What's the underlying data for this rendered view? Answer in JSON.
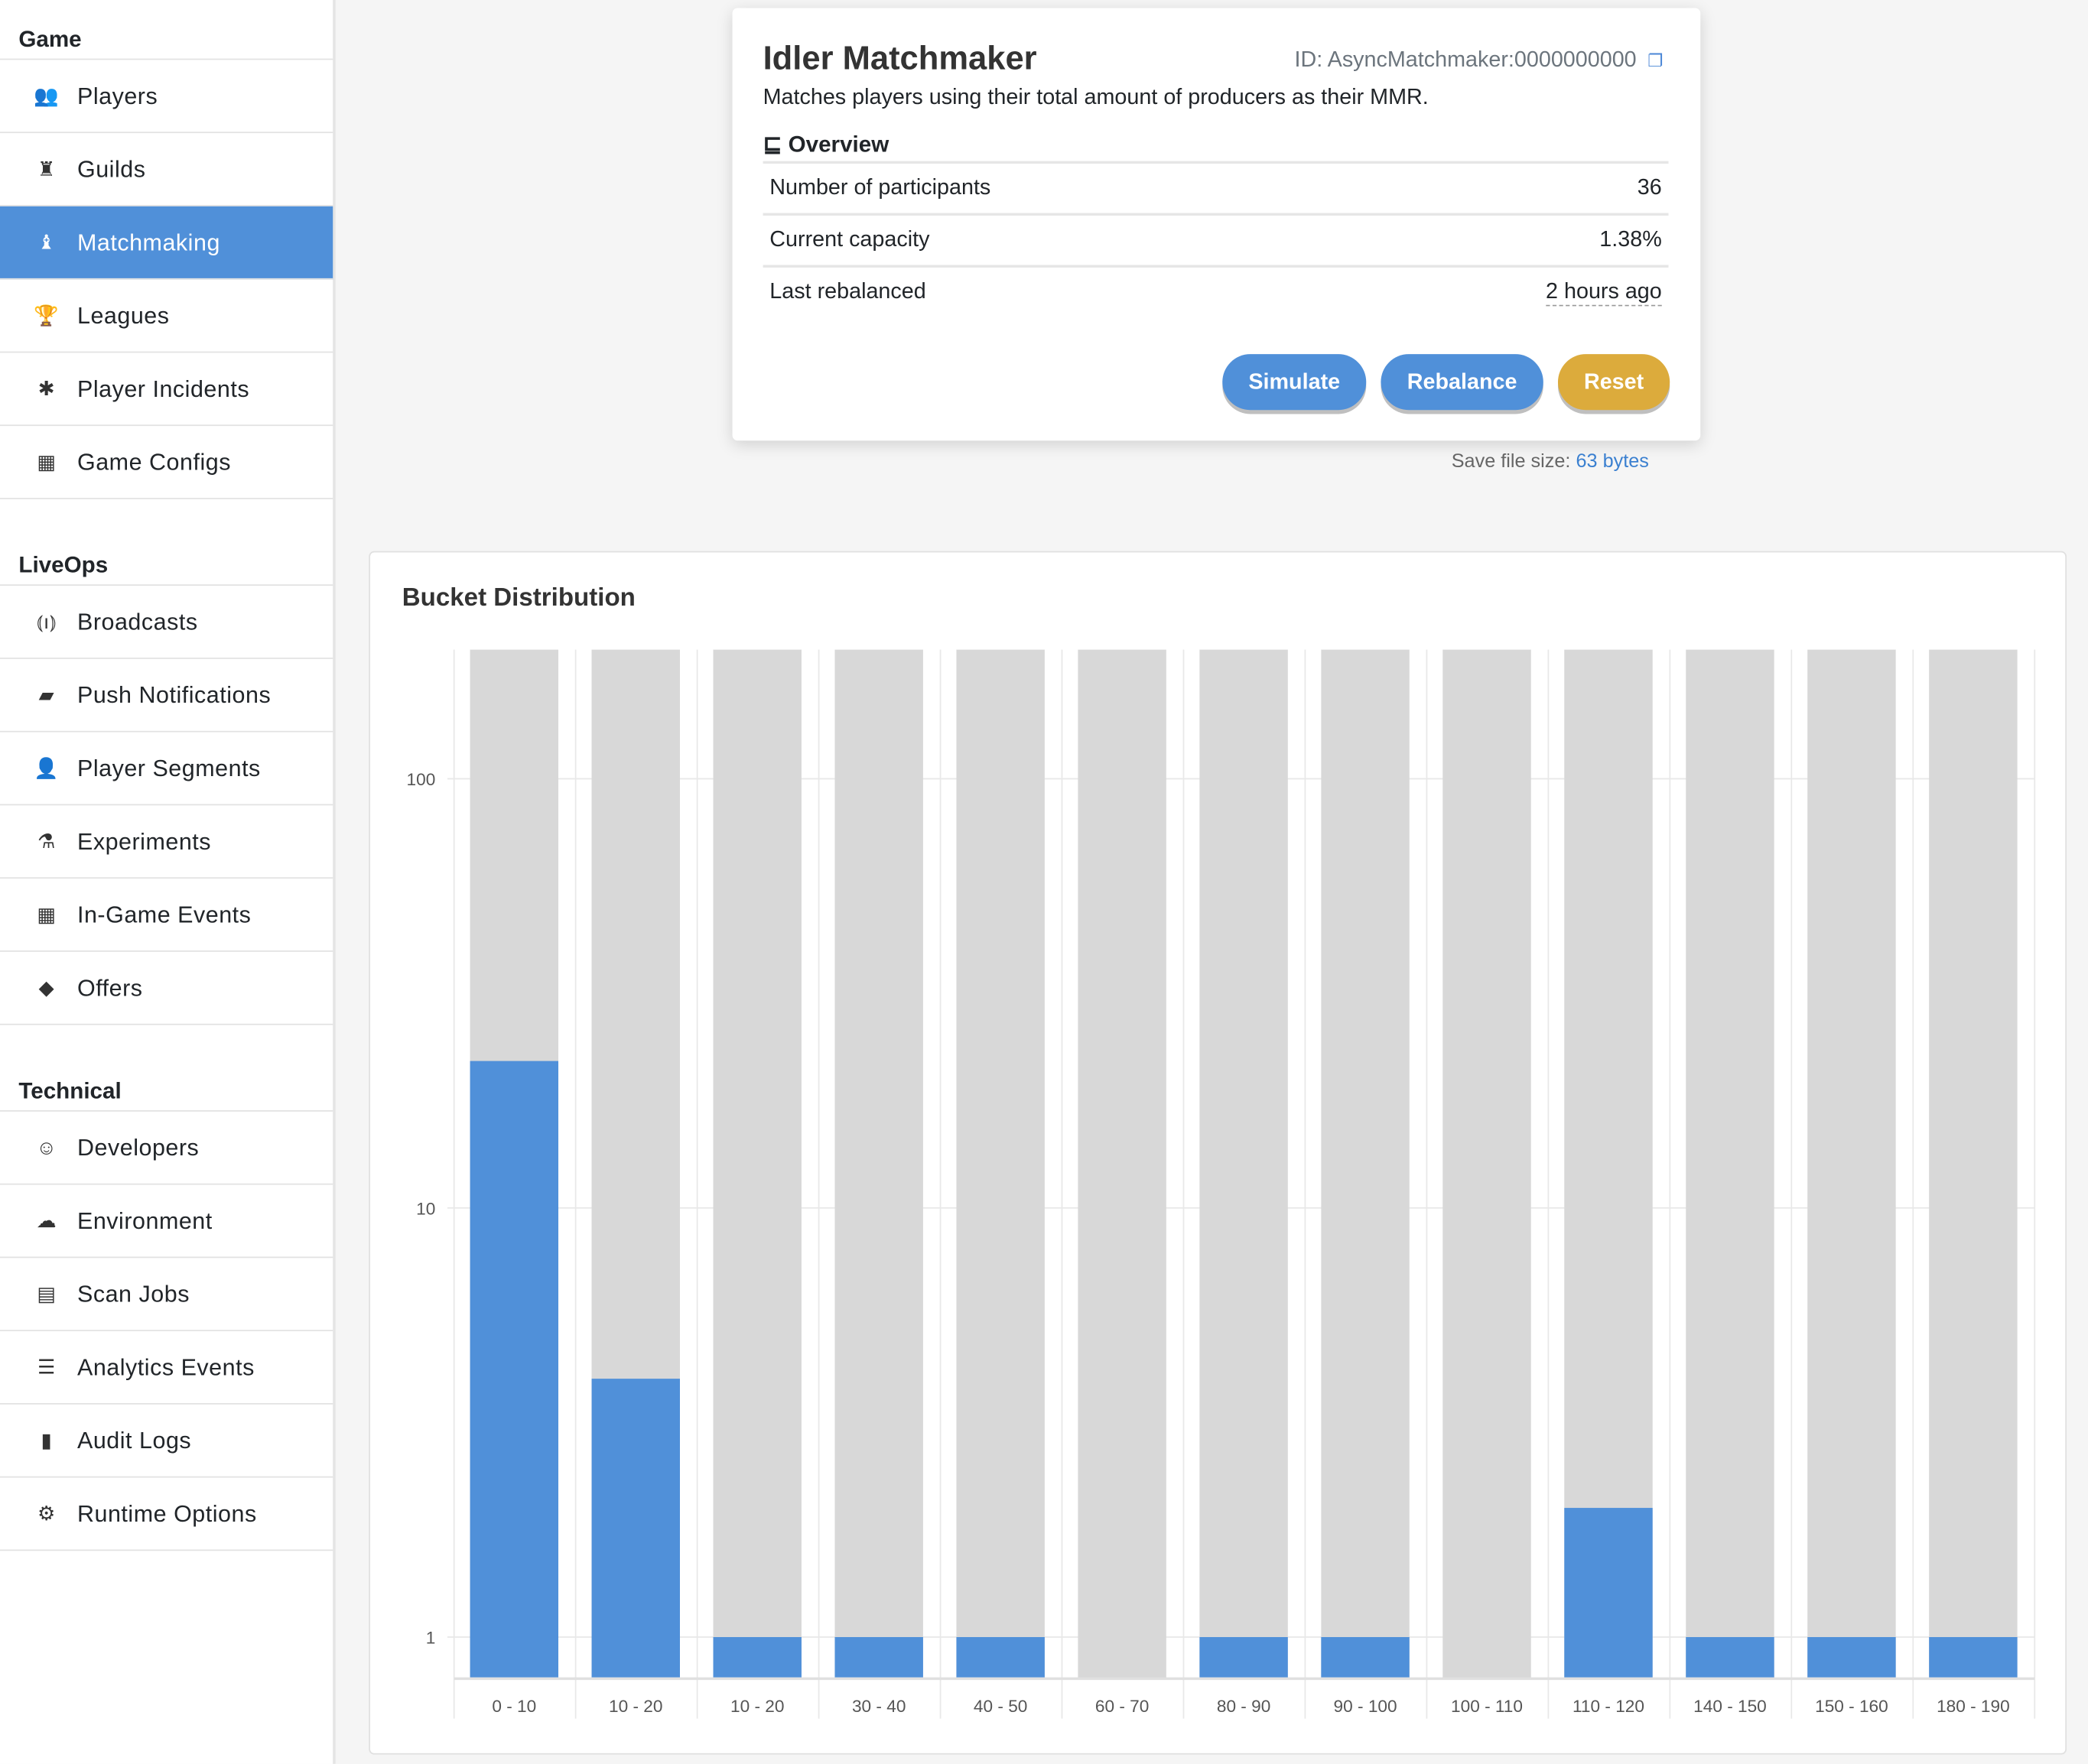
{
  "sidebar": {
    "sections": [
      {
        "title": "Game",
        "items": [
          {
            "label": "Players",
            "icon": "users-icon"
          },
          {
            "label": "Guilds",
            "icon": "chess-rook-icon"
          },
          {
            "label": "Matchmaking",
            "icon": "chess-icon",
            "active": true
          },
          {
            "label": "Leagues",
            "icon": "trophy-icon"
          },
          {
            "label": "Player Incidents",
            "icon": "bug-icon"
          },
          {
            "label": "Game Configs",
            "icon": "table-icon"
          }
        ]
      },
      {
        "title": "LiveOps",
        "items": [
          {
            "label": "Broadcasts",
            "icon": "broadcast-tower-icon"
          },
          {
            "label": "Push Notifications",
            "icon": "comment-icon"
          },
          {
            "label": "Player Segments",
            "icon": "user-tag-icon"
          },
          {
            "label": "Experiments",
            "icon": "flask-icon"
          },
          {
            "label": "In-Game Events",
            "icon": "calendar-icon"
          },
          {
            "label": "Offers",
            "icon": "tags-icon"
          }
        ]
      },
      {
        "title": "Technical",
        "items": [
          {
            "label": "Developers",
            "icon": "user-astronaut-icon"
          },
          {
            "label": "Environment",
            "icon": "cloud-icon"
          },
          {
            "label": "Scan Jobs",
            "icon": "business-time-icon"
          },
          {
            "label": "Analytics Events",
            "icon": "list-icon"
          },
          {
            "label": "Audit Logs",
            "icon": "clipboard-icon"
          },
          {
            "label": "Runtime Options",
            "icon": "cogs-icon"
          }
        ]
      }
    ]
  },
  "overview": {
    "title": "Idler Matchmaker",
    "id": "ID: AsyncMatchmaker:0000000000",
    "description": "Matches players using their total amount of producers as their MMR.",
    "section": "Overview",
    "rows": [
      {
        "label": "Number of participants",
        "value": "36"
      },
      {
        "label": "Current capacity",
        "value": "1.38%"
      },
      {
        "label": "Last rebalanced",
        "value": "2 hours ago"
      }
    ],
    "buttons": {
      "simulate": "Simulate",
      "rebalance": "Rebalance",
      "reset": "Reset"
    },
    "save_label": "Save file size:",
    "save_value": "63 bytes"
  },
  "colors": {
    "primary": "#5090d9",
    "warning": "#dcab3c",
    "bar_bg": "#d8d8d8"
  },
  "chart_data": {
    "type": "bar",
    "title": "Bucket Distribution",
    "y_scale": "log",
    "ylim": [
      0.8,
      200
    ],
    "y_ticks": [
      1,
      10,
      100
    ],
    "grid": true,
    "categories": [
      "0 - 10",
      "10 - 20",
      "10 - 20",
      "30 - 40",
      "40 - 50",
      "60 - 70",
      "80 - 90",
      "90 - 100",
      "100 - 110",
      "110 - 120",
      "140 - 150",
      "150 - 160",
      "180 - 190"
    ],
    "values": [
      22,
      4,
      1,
      1,
      1,
      0,
      1,
      1,
      0,
      2,
      1,
      1,
      1
    ]
  }
}
